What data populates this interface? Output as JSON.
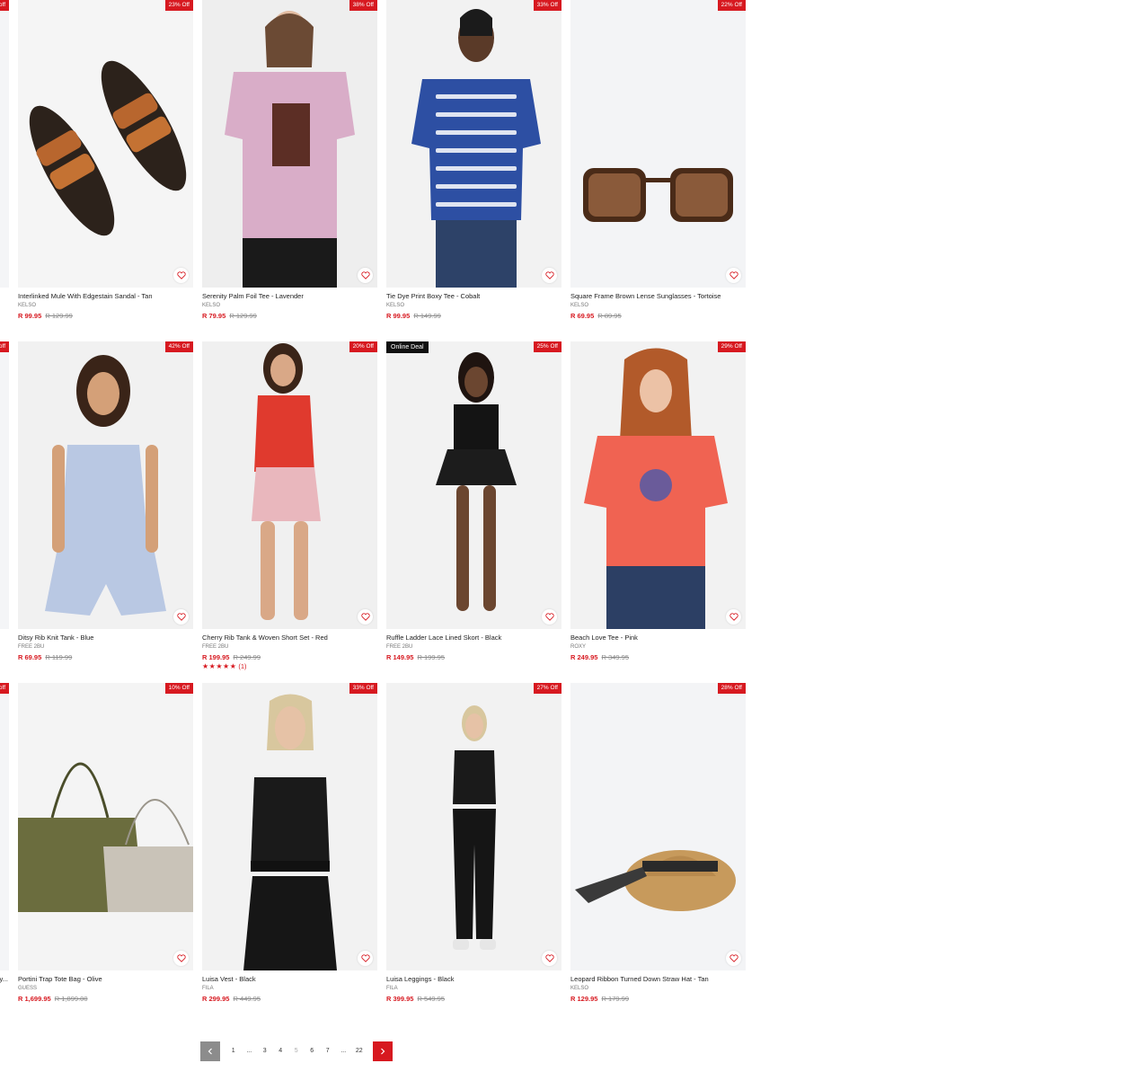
{
  "left_column": {
    "badges": [
      "off",
      "off",
      "off"
    ],
    "truncated_name": "y..."
  },
  "products": [
    {
      "name": "Interlinked Mule With Edgestain Sandal - Tan",
      "brand": "KELSO",
      "price": "R 99.95",
      "was": "R 129.99",
      "badge": "23% Off"
    },
    {
      "name": "Serenity Palm Foil Tee - Lavender",
      "brand": "KELSO",
      "price": "R 79.95",
      "was": "R 129.99",
      "badge": "38% Off"
    },
    {
      "name": "Tie Dye Print Boxy Tee - Cobalt",
      "brand": "KELSO",
      "price": "R 99.95",
      "was": "R 149.99",
      "badge": "33% Off"
    },
    {
      "name": "Square Frame Brown Lense Sunglasses - Tortoise",
      "brand": "KELSO",
      "price": "R 69.95",
      "was": "R 89.95",
      "badge": "22% Off"
    },
    {
      "name": "Ditsy Rib Knit Tank - Blue",
      "brand": "FREE 2BU",
      "price": "R 69.95",
      "was": "R 119.99",
      "badge": "42% Off"
    },
    {
      "name": "Cherry Rib Tank & Woven Short Set - Red",
      "brand": "FREE 2BU",
      "price": "R 199.95",
      "was": "R 249.99",
      "badge": "20% Off",
      "rating_stars": "★★★★★",
      "rating_count": "(1)",
      "rating": 5
    },
    {
      "name": "Ruffle Ladder Lace Lined Skort - Black",
      "brand": "FREE 2BU",
      "price": "R 149.95",
      "was": "R 199.95",
      "badge": "25% Off",
      "deal": "Online Deal"
    },
    {
      "name": "Beach Love Tee - Pink",
      "brand": "ROXY",
      "price": "R 249.95",
      "was": "R 349.95",
      "badge": "29% Off"
    },
    {
      "name": "Portini Trap Tote Bag - Olive",
      "brand": "GUESS",
      "price": "R 1,699.95",
      "was": "R 1,899.00",
      "badge": "10% Off"
    },
    {
      "name": "Luisa Vest - Black",
      "brand": "FILA",
      "price": "R 299.95",
      "was": "R 449.95",
      "badge": "33% Off"
    },
    {
      "name": "Luisa Leggings - Black",
      "brand": "FILA",
      "price": "R 399.95",
      "was": "R 549.95",
      "badge": "27% Off"
    },
    {
      "name": "Leopard Ribbon Turned Down Straw Hat - Tan",
      "brand": "KELSO",
      "price": "R 129.95",
      "was": "R 179.99",
      "badge": "28% Off"
    }
  ],
  "pagination": {
    "pages": [
      "1",
      "...",
      "3",
      "4",
      "5",
      "6",
      "7",
      "...",
      "22"
    ],
    "current": "5"
  },
  "colors": {
    "accent": "#d71920",
    "deal": "#111111",
    "image_bg": "#f4f5f7"
  },
  "icons": {
    "wishlist": "heart-icon",
    "prev": "chevron-left-icon",
    "next": "chevron-right-icon"
  }
}
